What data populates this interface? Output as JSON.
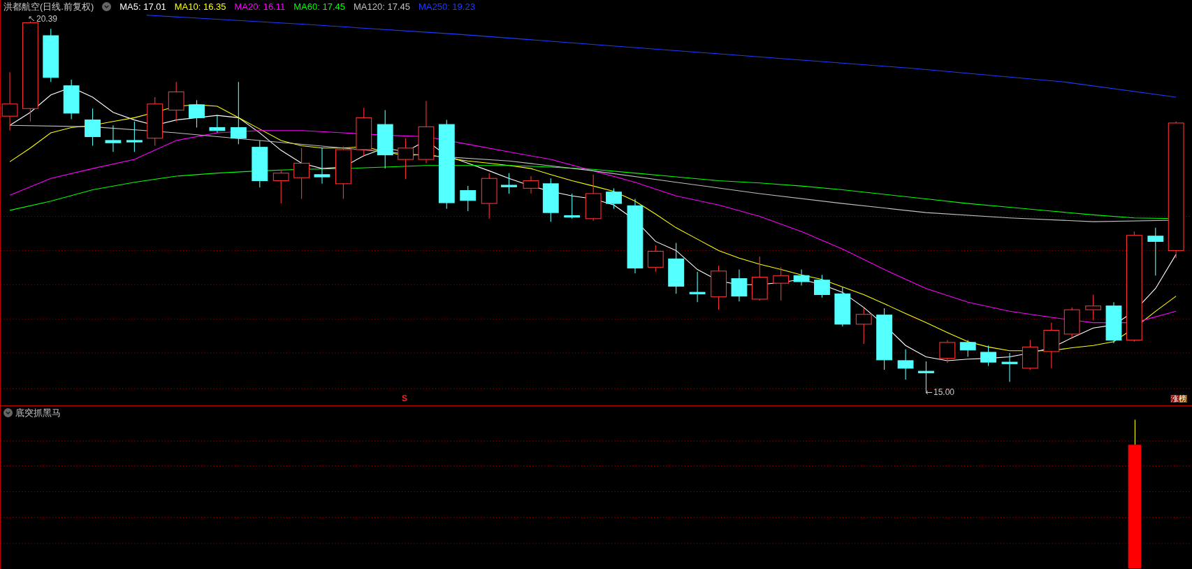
{
  "chart": {
    "title": "洪都航空(日线.前复权)",
    "ma_legend": [
      {
        "label": "MA5: 17.01",
        "color": "#ffffff"
      },
      {
        "label": "MA10: 16.35",
        "color": "#ffff00"
      },
      {
        "label": "MA20: 16.11",
        "color": "#ff00ff"
      },
      {
        "label": "MA60: 17.45",
        "color": "#00ff00"
      },
      {
        "label": "MA120: 17.45",
        "color": "#c0c0c0"
      },
      {
        "label": "MA250: 19.23",
        "color": "#1e3cff"
      }
    ],
    "high_label": "20.39",
    "low_label": "15.00",
    "signal_mark": "S",
    "badge": "涨榜"
  },
  "indicator": {
    "title": "底突抓黑马"
  }
}
